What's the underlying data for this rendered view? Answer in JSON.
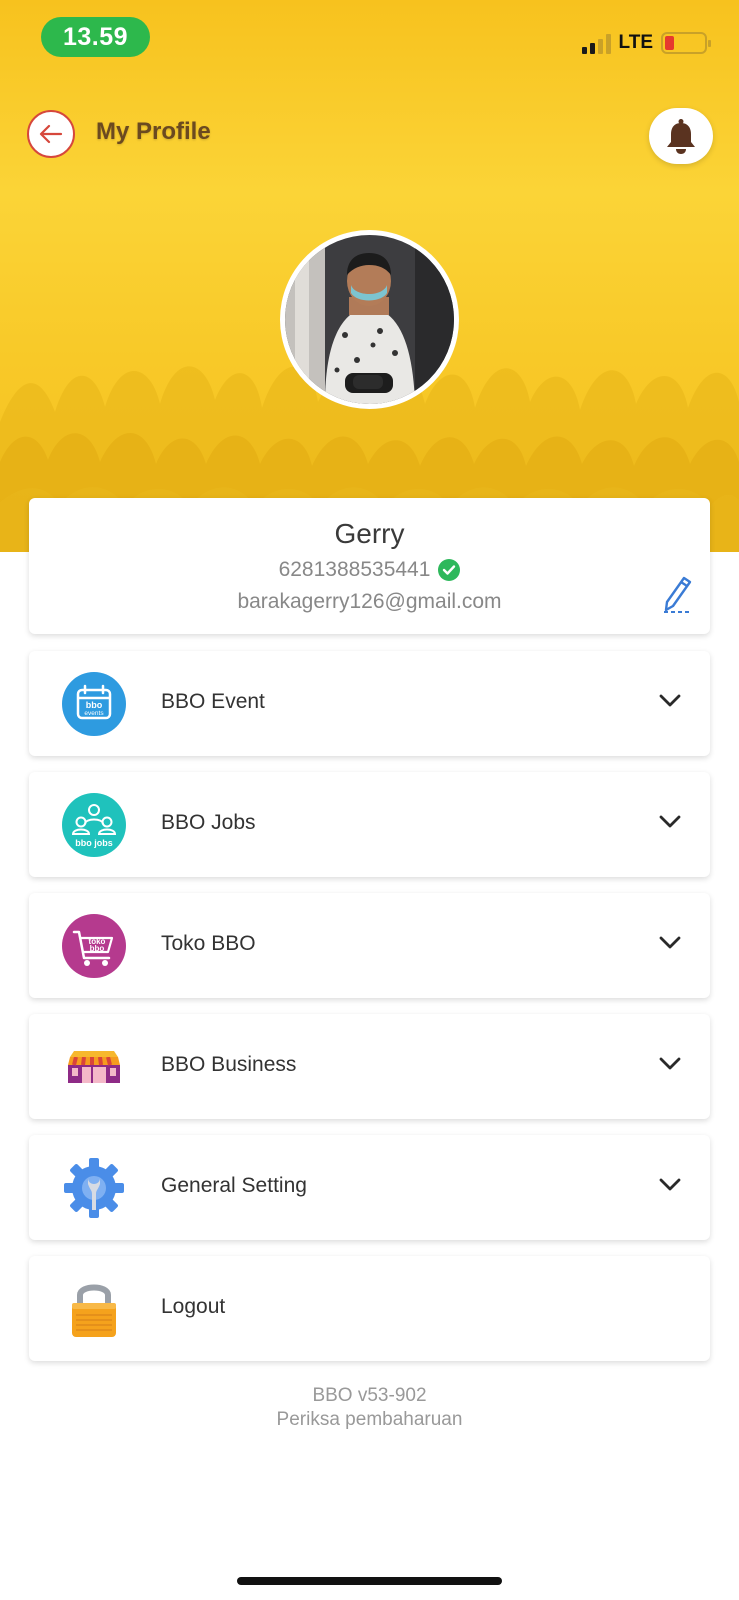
{
  "status_bar": {
    "time": "13.59",
    "network": "LTE",
    "signal_bars": 4,
    "signal_bars_strong": 2,
    "battery_level": 0.2
  },
  "header": {
    "title": "My Profile",
    "back_icon": "arrow-left-icon",
    "notification_icon": "bell-icon"
  },
  "profile": {
    "name": "Gerry",
    "phone": "6281388535441",
    "verified": true,
    "email": "barakagerry126@gmail.com",
    "edit_icon": "pencil-icon"
  },
  "menu": [
    {
      "label": "BBO Event",
      "icon": "bbo-events-icon",
      "expandable": true
    },
    {
      "label": "BBO Jobs",
      "icon": "bbo-jobs-icon",
      "expandable": true
    },
    {
      "label": "Toko BBO",
      "icon": "toko-bbo-icon",
      "expandable": true
    },
    {
      "label": "BBO Business",
      "icon": "storefront-icon",
      "expandable": true
    },
    {
      "label": "General Setting",
      "icon": "gear-wrench-icon",
      "expandable": true
    },
    {
      "label": "Logout",
      "icon": "padlock-icon",
      "expandable": false
    }
  ],
  "footer": {
    "version": "BBO v53-902",
    "update_link": "Periksa pembaharuan"
  },
  "colors": {
    "hero_yellow": "#fbd437",
    "accent_red": "#d6473c",
    "title_brown": "#6b4a20",
    "verified_green": "#2eb85c",
    "status_green": "#2db84c"
  }
}
